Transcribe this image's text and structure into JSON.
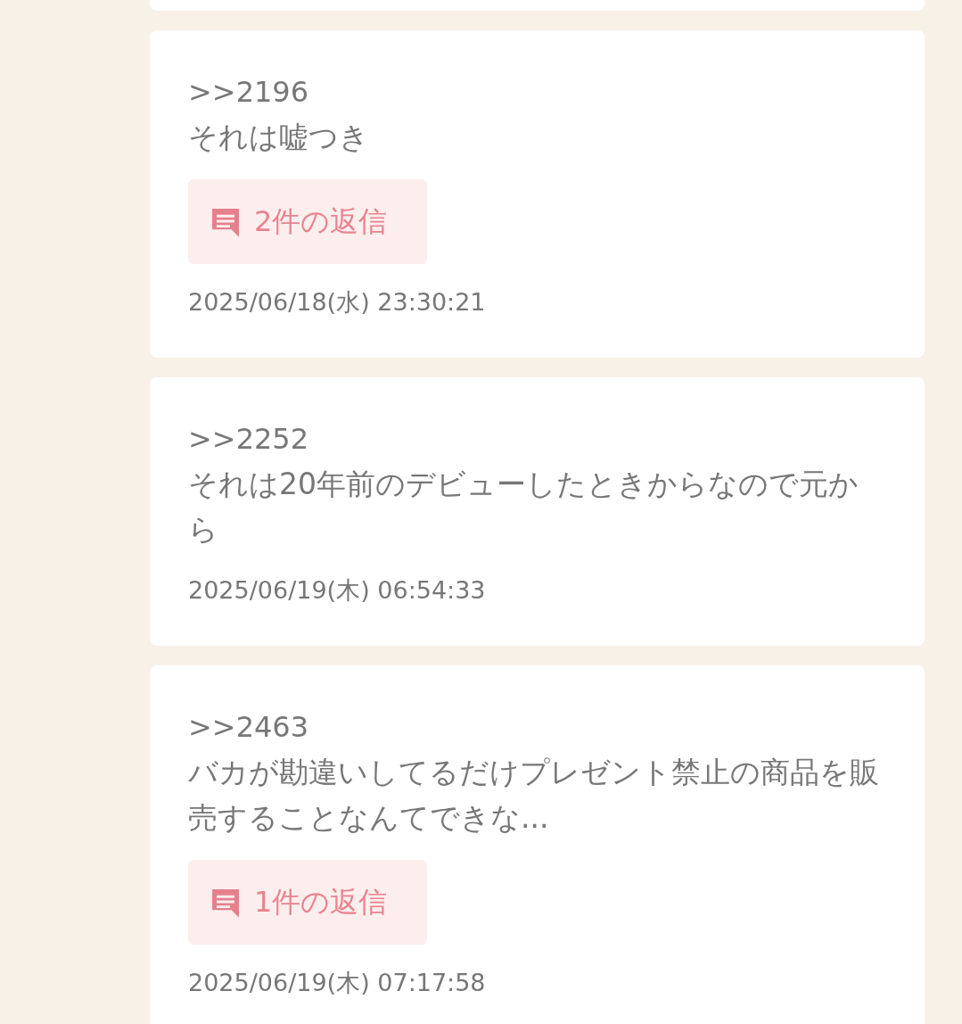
{
  "posts": [
    {
      "ref": ">>2196",
      "body": "それは嘘つき",
      "replies": "2件の返信",
      "date": "2025/06/18(水) 23:30:21"
    },
    {
      "ref": ">>2252",
      "body": "それは20年前のデビューしたときからなので元から",
      "date": "2025/06/19(木) 06:54:33"
    },
    {
      "ref": ">>2463",
      "body": "バカが勘違いしてるだけプレゼント禁止の商品を販売することなんてできな...",
      "replies": "1件の返信",
      "date": "2025/06/19(木) 07:17:58"
    }
  ]
}
